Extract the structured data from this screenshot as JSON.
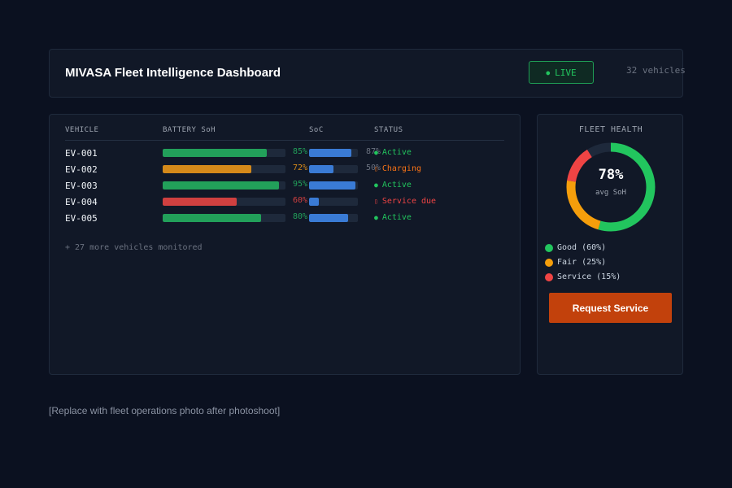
{
  "header": {
    "title": "MIVASA Fleet Intelligence Dashboard",
    "live_label": "LIVE",
    "live_dot": "●",
    "vehicle_count": "32 vehicles"
  },
  "table": {
    "columns": [
      "VEHICLE",
      "BATTERY SoH",
      "SoC",
      "STATUS"
    ],
    "rows": [
      {
        "id": "EV-001",
        "soh": 85,
        "soh_label": "85%",
        "soh_color": "#22a05a",
        "soc": 87,
        "soc_label": "87%",
        "status_icon": "●",
        "status": "Active",
        "status_color": "#22c55e"
      },
      {
        "id": "EV-002",
        "soh": 72,
        "soh_label": "72%",
        "soh_color": "#d4891a",
        "soc": 50,
        "soc_label": "50%",
        "status_icon": "▯",
        "status": "Charging",
        "status_color": "#f97316"
      },
      {
        "id": "EV-003",
        "soh": 95,
        "soh_label": "95%",
        "soh_color": "#22a05a",
        "soc": 95,
        "soc_label": "",
        "status_icon": "●",
        "status": "Active",
        "status_color": "#22c55e"
      },
      {
        "id": "EV-004",
        "soh": 60,
        "soh_label": "60%",
        "soh_color": "#d04040",
        "soc": 20,
        "soc_label": "",
        "status_icon": "▯",
        "status": "Service due",
        "status_color": "#ef4444"
      },
      {
        "id": "EV-005",
        "soh": 80,
        "soh_label": "80%",
        "soh_color": "#22a05a",
        "soc": 80,
        "soc_label": "",
        "status_icon": "●",
        "status": "Active",
        "status_color": "#22c55e"
      }
    ],
    "soc_color": "#3a7bd5",
    "more_note": "+ 27 more vehicles monitored"
  },
  "health": {
    "title": "FLEET HEALTH",
    "value": "78%",
    "sub": "avg SoH",
    "segments": [
      {
        "label": "Good (60%)",
        "share": 60,
        "color": "#22c55e"
      },
      {
        "label": "Fair (25%)",
        "share": 25,
        "color": "#f59e0b"
      },
      {
        "label": "Service (15%)",
        "share": 15,
        "color": "#ef4444"
      }
    ],
    "gap_share": 10,
    "gap_color": "#1e293b",
    "button_label": "Request Service"
  },
  "placeholder_text": "[Replace with fleet operations photo after photoshoot]"
}
